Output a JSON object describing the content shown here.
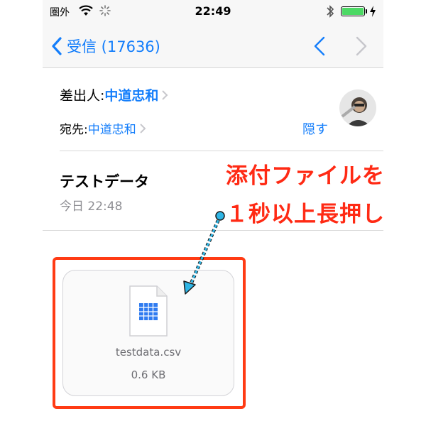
{
  "status_bar": {
    "carrier": "圏外",
    "time": "22:49"
  },
  "nav": {
    "back_label": "受信 (17636)"
  },
  "header": {
    "from_label": "差出人:",
    "from_name": "中道忠和",
    "to_label": "宛先:",
    "to_name": "中道忠和",
    "hide_label": "隠す"
  },
  "message": {
    "subject": "テストデータ",
    "date": "今日 22:48"
  },
  "attachment": {
    "file_name": "testdata.csv",
    "file_size": "0.6 KB"
  },
  "annotation": {
    "line1": "添付ファイルを",
    "line2": "１秒以上長押し"
  },
  "colors": {
    "accent": "#147efb",
    "annotation": "#ff2a14",
    "battery": "#4cd964"
  },
  "icons": [
    "wifi-icon",
    "activity-spinner-icon",
    "bluetooth-icon",
    "battery-icon",
    "charging-icon",
    "back-chevron-icon",
    "prev-arrow-icon",
    "next-arrow-icon",
    "spreadsheet-file-icon"
  ]
}
